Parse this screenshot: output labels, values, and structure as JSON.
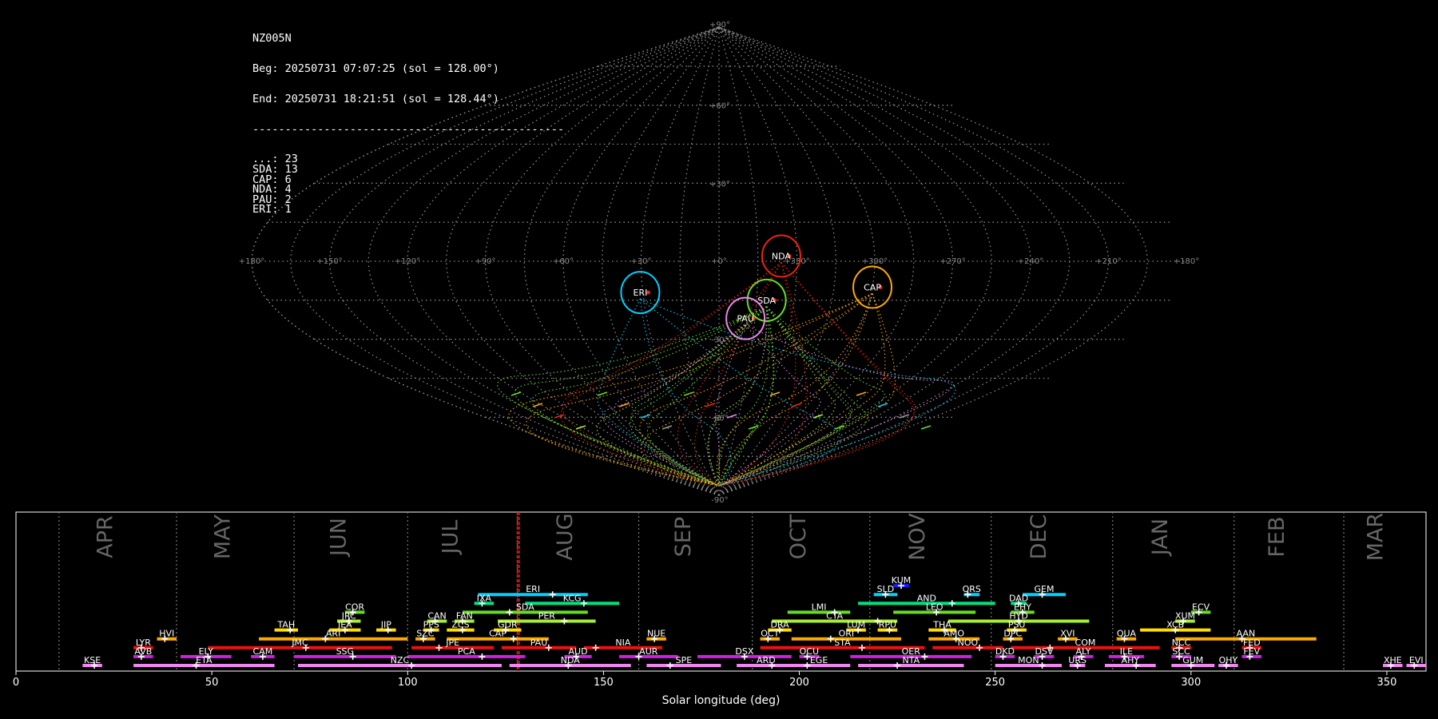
{
  "info": {
    "station": "NZ005N",
    "begin": "Beg: 20250731 07:07:25 (sol = 128.00°)",
    "end": "End: 20250731 18:21:51 (sol = 128.44°)",
    "separator": "------------------------------------------------",
    "counts": [
      {
        "code": "...",
        "count": 23
      },
      {
        "code": "SDA",
        "count": 13
      },
      {
        "code": "CAP",
        "count": 6
      },
      {
        "code": "NDA",
        "count": 4
      },
      {
        "code": "PAU",
        "count": 2
      },
      {
        "code": "ERI",
        "count": 1
      }
    ]
  },
  "chart_data": [
    {
      "type": "scatter",
      "projection": "sinusoidal",
      "lon_ticks": [
        "+180°",
        "+150°",
        "+120°",
        "+90°",
        "+60°",
        "+30°",
        "+0°",
        "+330°",
        "+300°",
        "+270°",
        "+240°",
        "+210°",
        "+180°"
      ],
      "lat_ticks": [
        "+90°",
        "+60°",
        "+30°",
        "-30°",
        "-60°",
        "-90°"
      ],
      "radiants": [
        {
          "code": "ERI",
          "lon": 31,
          "lat": -12,
          "color": "#00d0ff"
        },
        {
          "code": "NDA",
          "lon": 336,
          "lat": 2,
          "color": "#ee2211"
        },
        {
          "code": "SDA",
          "lon": 341,
          "lat": -15,
          "color": "#66dd22"
        },
        {
          "code": "PAU",
          "lon": 349,
          "lat": -22,
          "color": "#ee88ee"
        },
        {
          "code": "CAP",
          "lon": 300,
          "lat": -10,
          "color": "#ffaa00"
        }
      ]
    },
    {
      "type": "bar",
      "xlabel": "Solar longitude (deg)",
      "xlim": [
        0,
        360
      ],
      "x_ticks": [
        0,
        50,
        100,
        150,
        200,
        250,
        300,
        350
      ],
      "current_sol": [
        128.0,
        128.44
      ],
      "months": [
        {
          "label": "APR",
          "start": 11,
          "end": 41
        },
        {
          "label": "MAY",
          "start": 41,
          "end": 71
        },
        {
          "label": "JUN",
          "start": 71,
          "end": 100
        },
        {
          "label": "JUL",
          "start": 100,
          "end": 128
        },
        {
          "label": "AUG",
          "start": 128,
          "end": 159
        },
        {
          "label": "SEP",
          "start": 159,
          "end": 188
        },
        {
          "label": "OCT",
          "start": 188,
          "end": 218
        },
        {
          "label": "NOV",
          "start": 218,
          "end": 249
        },
        {
          "label": "DEC",
          "start": 249,
          "end": 280
        },
        {
          "label": "JAN",
          "start": 280,
          "end": 311
        },
        {
          "label": "FEB",
          "start": 311,
          "end": 339
        },
        {
          "label": "MAR",
          "start": 339,
          "end": 360
        }
      ],
      "showers": [
        {
          "code": "KUM",
          "start": 224,
          "end": 228,
          "peak": 226,
          "row": 11,
          "color": "#1a1aff"
        },
        {
          "code": "ERI",
          "start": 118,
          "end": 146,
          "peak": 137,
          "row": 10,
          "color": "#00d0ff"
        },
        {
          "code": "SLD",
          "start": 219,
          "end": 225,
          "peak": 222,
          "row": 10,
          "color": "#00d0ff"
        },
        {
          "code": "ORS",
          "start": 242,
          "end": 246,
          "peak": 243,
          "row": 10,
          "color": "#00d0ff"
        },
        {
          "code": "GEM",
          "start": 257,
          "end": 268,
          "peak": 262,
          "row": 10,
          "color": "#00d0ff"
        },
        {
          "code": "IXA",
          "start": 117,
          "end": 122,
          "peak": 119,
          "row": 9,
          "color": "#00e080"
        },
        {
          "code": "KCG",
          "start": 130,
          "end": 154,
          "peak": 145,
          "row": 9,
          "color": "#00e080"
        },
        {
          "code": "AND",
          "start": 215,
          "end": 250,
          "peak": 239,
          "row": 9,
          "color": "#00e080"
        },
        {
          "code": "DAD",
          "start": 254,
          "end": 258,
          "peak": 256,
          "row": 9,
          "color": "#00e080"
        },
        {
          "code": "COR",
          "start": 84,
          "end": 89,
          "peak": 86,
          "row": 8,
          "color": "#66dd22"
        },
        {
          "code": "SDA",
          "start": 114,
          "end": 146,
          "peak": 126,
          "row": 8,
          "color": "#66dd22"
        },
        {
          "code": "LMI",
          "start": 197,
          "end": 213,
          "peak": 209,
          "row": 8,
          "color": "#66dd22"
        },
        {
          "code": "LEO",
          "start": 224,
          "end": 245,
          "peak": 235,
          "row": 8,
          "color": "#66dd22"
        },
        {
          "code": "EHY",
          "start": 254,
          "end": 260,
          "peak": 257,
          "row": 8,
          "color": "#66dd22"
        },
        {
          "code": "ECV",
          "start": 300,
          "end": 305,
          "peak": 302,
          "row": 8,
          "color": "#66dd22"
        },
        {
          "code": "JRC",
          "start": 82,
          "end": 88,
          "peak": 85,
          "row": 7,
          "color": "#aaee33"
        },
        {
          "code": "CAN",
          "start": 105,
          "end": 110,
          "peak": 107,
          "row": 7,
          "color": "#aaee33"
        },
        {
          "code": "FAN",
          "start": 112,
          "end": 117,
          "peak": 114,
          "row": 7,
          "color": "#aaee33"
        },
        {
          "code": "PER",
          "start": 123,
          "end": 148,
          "peak": 140,
          "row": 7,
          "color": "#aaee33"
        },
        {
          "code": "CTA",
          "start": 193,
          "end": 225,
          "peak": 220,
          "row": 7,
          "color": "#aaee33"
        },
        {
          "code": "HYD",
          "start": 238,
          "end": 274,
          "peak": 256,
          "row": 7,
          "color": "#aaee33"
        },
        {
          "code": "XUM",
          "start": 296,
          "end": 301,
          "peak": 298,
          "row": 7,
          "color": "#aaee33"
        },
        {
          "code": "TAH",
          "start": 66,
          "end": 72,
          "peak": 70,
          "row": 6,
          "color": "#ffdd00"
        },
        {
          "code": "JEA",
          "start": 80,
          "end": 88,
          "peak": 84,
          "row": 6,
          "color": "#ffdd00"
        },
        {
          "code": "JIP",
          "start": 92,
          "end": 97,
          "peak": 95,
          "row": 6,
          "color": "#ffdd00"
        },
        {
          "code": "PPS",
          "start": 104,
          "end": 108,
          "peak": 106,
          "row": 6,
          "color": "#ffdd00"
        },
        {
          "code": "ZCS",
          "start": 110,
          "end": 117,
          "peak": 114,
          "row": 6,
          "color": "#ffdd00"
        },
        {
          "code": "GDR",
          "start": 122,
          "end": 129,
          "peak": 125,
          "row": 6,
          "color": "#ffdd00"
        },
        {
          "code": "DRA",
          "start": 192,
          "end": 198,
          "peak": 195,
          "row": 6,
          "color": "#ffdd00"
        },
        {
          "code": "LUM",
          "start": 212,
          "end": 217,
          "peak": 215,
          "row": 6,
          "color": "#ffdd00"
        },
        {
          "code": "RPU",
          "start": 220,
          "end": 225,
          "peak": 223,
          "row": 6,
          "color": "#ffdd00"
        },
        {
          "code": "THA",
          "start": 233,
          "end": 240,
          "peak": 237,
          "row": 6,
          "color": "#ffdd00"
        },
        {
          "code": "PSU",
          "start": 253,
          "end": 258,
          "peak": 255,
          "row": 6,
          "color": "#ffdd00"
        },
        {
          "code": "XCB",
          "start": 287,
          "end": 305,
          "peak": 296,
          "row": 6,
          "color": "#ffdd00"
        },
        {
          "code": "HVI",
          "start": 36,
          "end": 41,
          "peak": 38,
          "row": 5,
          "color": "#ffaa00"
        },
        {
          "code": "ARI",
          "start": 62,
          "end": 100,
          "peak": 79,
          "row": 5,
          "color": "#ffaa00"
        },
        {
          "code": "SZC",
          "start": 102,
          "end": 107,
          "peak": 104,
          "row": 5,
          "color": "#ffaa00"
        },
        {
          "code": "CAP",
          "start": 110,
          "end": 136,
          "peak": 127,
          "row": 5,
          "color": "#ffaa00"
        },
        {
          "code": "NUE",
          "start": 161,
          "end": 166,
          "peak": 163,
          "row": 5,
          "color": "#ffaa00"
        },
        {
          "code": "OCT",
          "start": 190,
          "end": 195,
          "peak": 192,
          "row": 5,
          "color": "#ffaa00"
        },
        {
          "code": "ORI",
          "start": 198,
          "end": 226,
          "peak": 208,
          "row": 5,
          "color": "#ffaa00"
        },
        {
          "code": "AMO",
          "start": 233,
          "end": 246,
          "peak": 240,
          "row": 5,
          "color": "#ffaa00"
        },
        {
          "code": "DPC",
          "start": 252,
          "end": 257,
          "peak": 254,
          "row": 5,
          "color": "#ffaa00"
        },
        {
          "code": "XVI",
          "start": 266,
          "end": 271,
          "peak": 268,
          "row": 5,
          "color": "#ffaa00"
        },
        {
          "code": "QUA",
          "start": 281,
          "end": 286,
          "peak": 283,
          "row": 5,
          "color": "#ffaa00"
        },
        {
          "code": "AAN",
          "start": 296,
          "end": 332,
          "peak": 313,
          "row": 5,
          "color": "#ffaa00"
        },
        {
          "code": "LYR",
          "start": 30,
          "end": 35,
          "peak": 32,
          "row": 4,
          "color": "#ee1111"
        },
        {
          "code": "JMC",
          "start": 49,
          "end": 96,
          "peak": 74,
          "row": 4,
          "color": "#ee1111"
        },
        {
          "code": "JPE",
          "start": 101,
          "end": 122,
          "peak": 108,
          "row": 4,
          "color": "#ee1111"
        },
        {
          "code": "PAU",
          "start": 124,
          "end": 143,
          "peak": 136,
          "row": 4,
          "color": "#ee1111"
        },
        {
          "code": "NIA",
          "start": 145,
          "end": 165,
          "peak": 148,
          "row": 4,
          "color": "#ee1111"
        },
        {
          "code": "STA",
          "start": 190,
          "end": 232,
          "peak": 216,
          "row": 4,
          "color": "#ee1111"
        },
        {
          "code": "NOO",
          "start": 234,
          "end": 252,
          "peak": 246,
          "row": 4,
          "color": "#ee1111"
        },
        {
          "code": "COM",
          "start": 254,
          "end": 292,
          "peak": 264,
          "row": 4,
          "color": "#ee1111"
        },
        {
          "code": "NCC",
          "start": 295,
          "end": 300,
          "peak": 297,
          "row": 4,
          "color": "#ee1111"
        },
        {
          "code": "FED",
          "start": 313,
          "end": 318,
          "peak": 315,
          "row": 4,
          "color": "#ee1111"
        },
        {
          "code": "AVB",
          "start": 30,
          "end": 35,
          "peak": 32,
          "row": 3,
          "color": "#cc22dd"
        },
        {
          "code": "ELY",
          "start": 42,
          "end": 55,
          "peak": 49,
          "row": 3,
          "color": "#cc22dd"
        },
        {
          "code": "CAM",
          "start": 60,
          "end": 66,
          "peak": 63,
          "row": 3,
          "color": "#cc22dd"
        },
        {
          "code": "SSG",
          "start": 71,
          "end": 97,
          "peak": 86,
          "row": 3,
          "color": "#cc22dd"
        },
        {
          "code": "PCA",
          "start": 100,
          "end": 130,
          "peak": 119,
          "row": 3,
          "color": "#cc22dd"
        },
        {
          "code": "AUD",
          "start": 140,
          "end": 147,
          "peak": 143,
          "row": 3,
          "color": "#cc22dd"
        },
        {
          "code": "AUR",
          "start": 154,
          "end": 169,
          "peak": 159,
          "row": 3,
          "color": "#cc22dd"
        },
        {
          "code": "DSX",
          "start": 174,
          "end": 198,
          "peak": 186,
          "row": 3,
          "color": "#cc22dd"
        },
        {
          "code": "OCU",
          "start": 200,
          "end": 205,
          "peak": 202,
          "row": 3,
          "color": "#cc22dd"
        },
        {
          "code": "OER",
          "start": 213,
          "end": 244,
          "peak": 232,
          "row": 3,
          "color": "#cc22dd"
        },
        {
          "code": "DKD",
          "start": 250,
          "end": 255,
          "peak": 252,
          "row": 3,
          "color": "#cc22dd"
        },
        {
          "code": "DSV",
          "start": 260,
          "end": 265,
          "peak": 262,
          "row": 3,
          "color": "#cc22dd"
        },
        {
          "code": "ALY",
          "start": 270,
          "end": 275,
          "peak": 272,
          "row": 3,
          "color": "#cc22dd"
        },
        {
          "code": "ILE",
          "start": 279,
          "end": 288,
          "peak": 283,
          "row": 3,
          "color": "#cc22dd"
        },
        {
          "code": "SCC",
          "start": 295,
          "end": 300,
          "peak": 297,
          "row": 3,
          "color": "#cc22dd"
        },
        {
          "code": "FEV",
          "start": 313,
          "end": 318,
          "peak": 315,
          "row": 3,
          "color": "#cc22dd"
        },
        {
          "code": "KSE",
          "start": 17,
          "end": 22,
          "peak": 20,
          "row": 2,
          "color": "#ee88ee"
        },
        {
          "code": "ETA",
          "start": 30,
          "end": 66,
          "peak": 46,
          "row": 2,
          "color": "#ee88ee"
        },
        {
          "code": "NZC",
          "start": 72,
          "end": 124,
          "peak": 101,
          "row": 2,
          "color": "#ee88ee"
        },
        {
          "code": "NDA",
          "start": 126,
          "end": 157,
          "peak": 141,
          "row": 2,
          "color": "#ee88ee"
        },
        {
          "code": "SPE",
          "start": 161,
          "end": 180,
          "peak": 167,
          "row": 2,
          "color": "#ee88ee"
        },
        {
          "code": "ARD",
          "start": 184,
          "end": 199,
          "peak": 193,
          "row": 2,
          "color": "#ee88ee"
        },
        {
          "code": "EGE",
          "start": 197,
          "end": 213,
          "peak": 202,
          "row": 2,
          "color": "#ee88ee"
        },
        {
          "code": "NTA",
          "start": 215,
          "end": 242,
          "peak": 225,
          "row": 2,
          "color": "#ee88ee"
        },
        {
          "code": "MON",
          "start": 250,
          "end": 267,
          "peak": 262,
          "row": 2,
          "color": "#ee88ee"
        },
        {
          "code": "URS",
          "start": 269,
          "end": 273,
          "peak": 271,
          "row": 2,
          "color": "#ee88ee"
        },
        {
          "code": "AHY",
          "start": 278,
          "end": 291,
          "peak": 286,
          "row": 2,
          "color": "#ee88ee"
        },
        {
          "code": "GUM",
          "start": 295,
          "end": 306,
          "peak": 300,
          "row": 2,
          "color": "#ee88ee"
        },
        {
          "code": "OHY",
          "start": 307,
          "end": 312,
          "peak": 309,
          "row": 2,
          "color": "#ee88ee"
        },
        {
          "code": "XHE",
          "start": 349,
          "end": 354,
          "peak": 351,
          "row": 2,
          "color": "#ee88ee"
        },
        {
          "code": "EVI",
          "start": 355,
          "end": 360,
          "peak": 357,
          "row": 2,
          "color": "#ee88ee"
        }
      ]
    }
  ]
}
